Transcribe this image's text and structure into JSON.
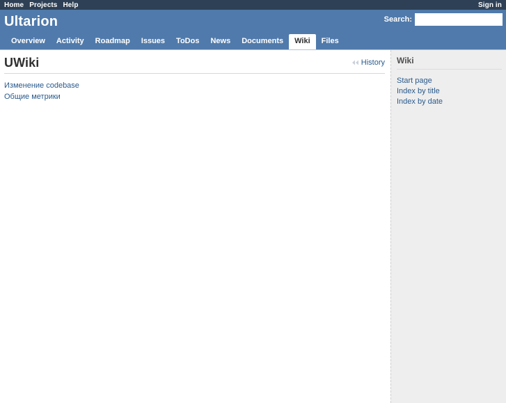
{
  "top_menu": {
    "left_items": [
      {
        "label": "Home",
        "name": "top-menu-home"
      },
      {
        "label": "Projects",
        "name": "top-menu-projects"
      },
      {
        "label": "Help",
        "name": "top-menu-help"
      }
    ],
    "right_items": [
      {
        "label": "Sign in",
        "name": "top-menu-sign-in"
      }
    ]
  },
  "header": {
    "app_title": "Ultarion",
    "search": {
      "label": "Search:",
      "value": "",
      "placeholder": ""
    }
  },
  "main_menu": {
    "tabs": [
      {
        "label": "Overview",
        "name": "tab-overview",
        "selected": false
      },
      {
        "label": "Activity",
        "name": "tab-activity",
        "selected": false
      },
      {
        "label": "Roadmap",
        "name": "tab-roadmap",
        "selected": false
      },
      {
        "label": "Issues",
        "name": "tab-issues",
        "selected": false
      },
      {
        "label": "ToDos",
        "name": "tab-todos",
        "selected": false
      },
      {
        "label": "News",
        "name": "tab-news",
        "selected": false
      },
      {
        "label": "Documents",
        "name": "tab-documents",
        "selected": false
      },
      {
        "label": "Wiki",
        "name": "tab-wiki",
        "selected": true
      },
      {
        "label": "Files",
        "name": "tab-files",
        "selected": false
      }
    ]
  },
  "content": {
    "page_title": "UWiki",
    "contextual": {
      "history_label": "History",
      "history_icon": "rewind-icon"
    },
    "wiki_pages": [
      {
        "label": "Изменение codebase",
        "name": "wiki-page-link"
      },
      {
        "label": "Общие метрики",
        "name": "wiki-page-link"
      }
    ]
  },
  "sidebar": {
    "heading": "Wiki",
    "links": [
      {
        "label": "Start page",
        "name": "sidebar-link-start-page"
      },
      {
        "label": "Index by title",
        "name": "sidebar-link-index-by-title"
      },
      {
        "label": "Index by date",
        "name": "sidebar-link-index-by-date"
      }
    ]
  },
  "colors": {
    "top_bar": "#2e4055",
    "header_blue": "#507aab",
    "link_blue": "#2a5a8c",
    "sidebar_bg": "#eeeeee",
    "body_text": "#484848"
  }
}
